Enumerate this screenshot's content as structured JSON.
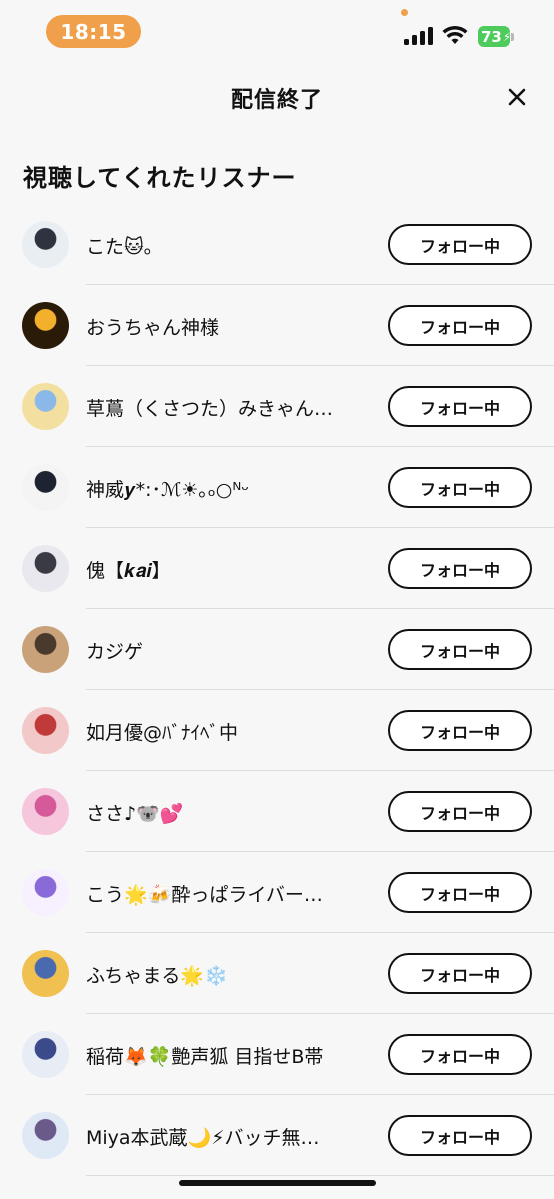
{
  "status_bar": {
    "time": "18:15",
    "battery": "73",
    "colors": {
      "accent": "#f0a04b",
      "battery": "#4fca5d"
    }
  },
  "header": {
    "title": "配信終了",
    "close_icon": "close-icon"
  },
  "section_title": "視聴してくれたリスナー",
  "follow_label": "フォロー中",
  "listeners": [
    {
      "name": "こた🐱｡",
      "avatar_colors": [
        "#e9eef3",
        "#2d3440"
      ]
    },
    {
      "name": "おうちゃん神様",
      "avatar_colors": [
        "#2a1a08",
        "#f3b02c"
      ]
    },
    {
      "name": "草蔦（くさつた）みきゃん…",
      "avatar_colors": [
        "#f3e0a0",
        "#8ab8e8"
      ]
    },
    {
      "name": "神威𝒚*:･ℳ☀︎｡ₒ○ᴺᵕ",
      "avatar_colors": [
        "#f4f4f4",
        "#1d2330"
      ]
    },
    {
      "name": "傀【𝒌𝒂𝒊】",
      "avatar_colors": [
        "#e8e8ee",
        "#3a3a45"
      ]
    },
    {
      "name": "カジゲ",
      "avatar_colors": [
        "#c9a27a",
        "#4a3a2e"
      ]
    },
    {
      "name": "如月優@ﾊﾞﾅｲﾍﾞ中",
      "avatar_colors": [
        "#f3c8c8",
        "#c03a3a"
      ]
    },
    {
      "name": "ささ♪🐨💕",
      "avatar_colors": [
        "#f5c6dc",
        "#d45a9a"
      ]
    },
    {
      "name": "こう🌟🍻酔っぱライバー…",
      "avatar_colors": [
        "#f6f0ff",
        "#8a6ad8"
      ]
    },
    {
      "name": "ふちゃまる🌟❄️",
      "avatar_colors": [
        "#f0c050",
        "#4a6ab0"
      ]
    },
    {
      "name": "稲荷🦊🍀艶声狐 目指せB帯",
      "avatar_colors": [
        "#e8ecf5",
        "#3a4a8a"
      ]
    },
    {
      "name": "Miya本武蔵🌙⚡バッチ無…",
      "avatar_colors": [
        "#dfe8f5",
        "#6a5a8a"
      ]
    }
  ]
}
